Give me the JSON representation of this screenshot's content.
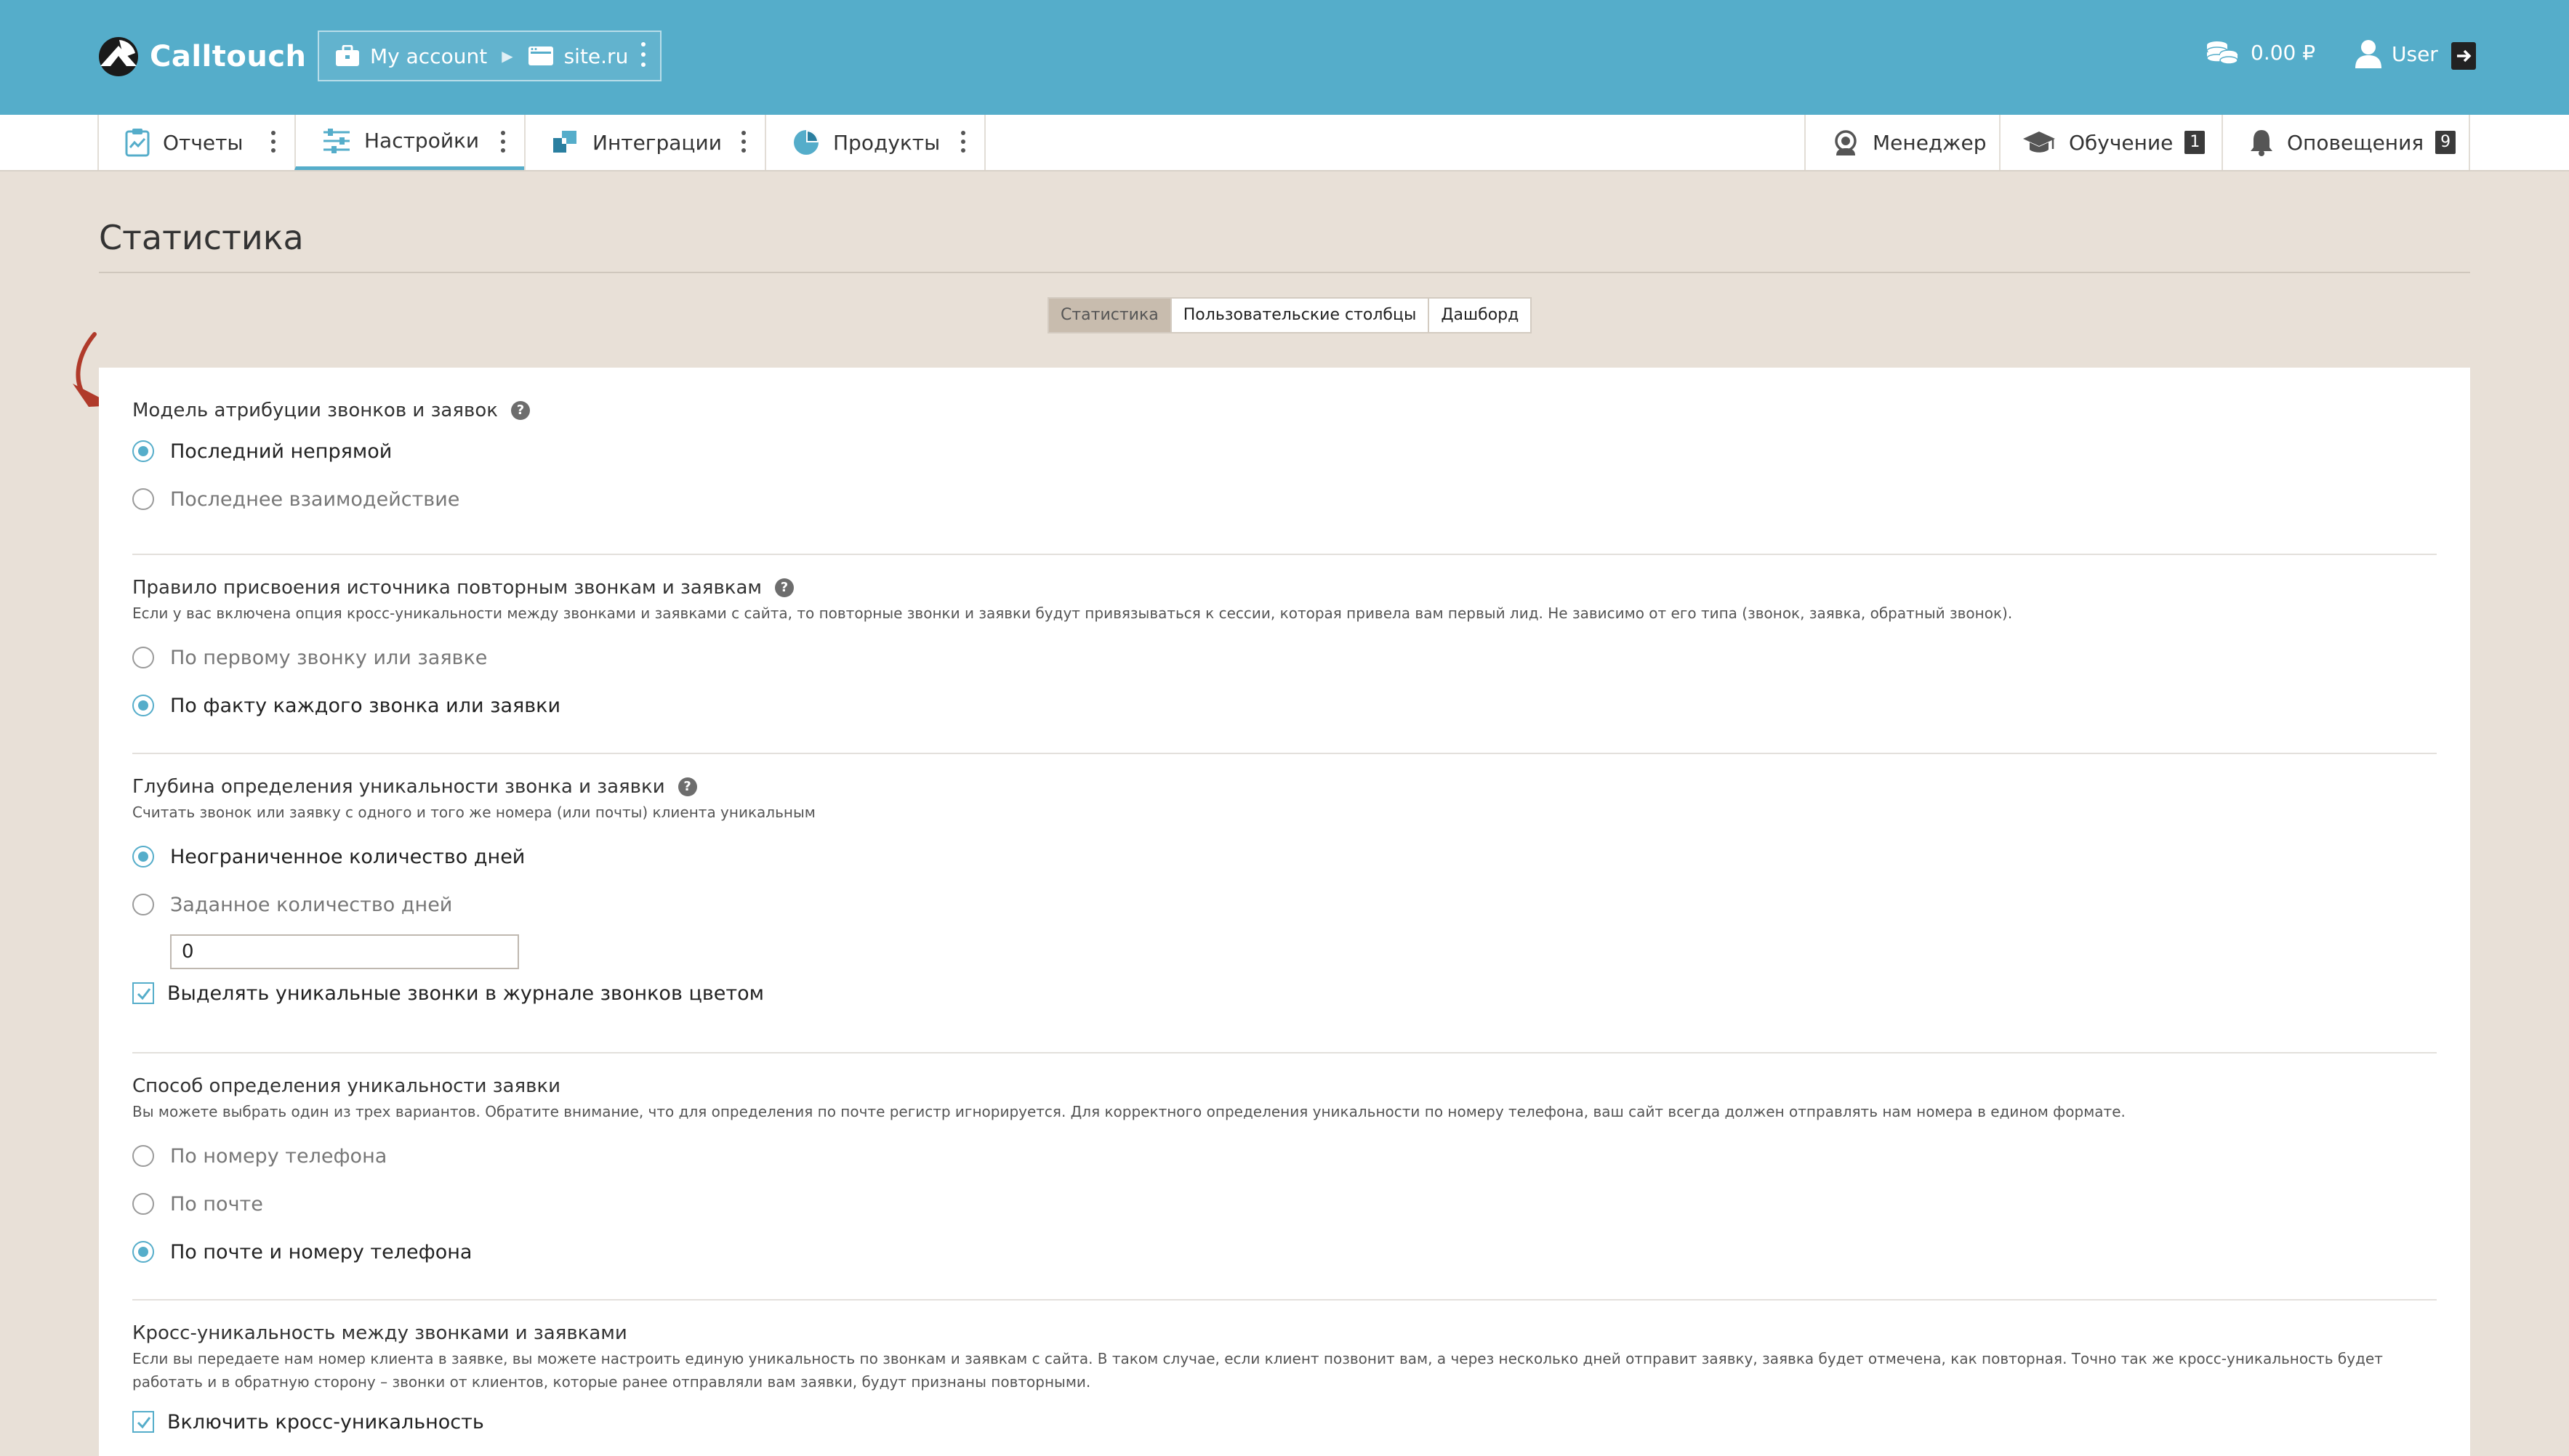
{
  "app": {
    "name": "Calltouch",
    "account_label": "My account",
    "site_label": "site.ru",
    "balance": "0.00 ₽",
    "user_label": "User"
  },
  "nav": {
    "left": [
      {
        "label": "Отчеты",
        "icon": "clipboard-chart-icon"
      },
      {
        "label": "Настройки",
        "icon": "sliders-icon",
        "active": true
      },
      {
        "label": "Интеграции",
        "icon": "puzzle-icon"
      },
      {
        "label": "Продукты",
        "icon": "pie-chart-icon"
      }
    ],
    "right": [
      {
        "label": "Менеджер",
        "icon": "headset-icon"
      },
      {
        "label": "Обучение",
        "icon": "graduation-cap-icon",
        "badge": "1"
      },
      {
        "label": "Оповещения",
        "icon": "bell-icon",
        "badge": "9"
      }
    ]
  },
  "page": {
    "title": "Статистика",
    "subtabs": [
      "Статистика",
      "Пользовательские столбцы",
      "Дашборд"
    ],
    "active_subtab": 0
  },
  "sections": {
    "attribution": {
      "title": "Модель атрибуции звонков и заявок",
      "options": [
        "Последний непрямой",
        "Последнее взаимодействие"
      ],
      "selected": 0
    },
    "repeat_rule": {
      "title": "Правило присвоения источника повторным звонкам и заявкам",
      "desc": "Если у вас включена опция кросс-уникальности между звонками и заявками с сайта, то повторные звонки и заявки будут привязываться к сессии, которая привела вам первый лид. Не зависимо от его типа (звонок, заявка, обратный звонок).",
      "options": [
        "По первому звонку или заявке",
        "По факту каждого звонка или заявки"
      ],
      "selected": 1
    },
    "uniqueness_depth": {
      "title": "Глубина определения уникальности звонка и заявки",
      "desc": "Считать звонок или заявку с одного и того же номера (или почты) клиента уникальным",
      "options": [
        "Неограниченное количество дней",
        "Заданное количество дней"
      ],
      "selected": 0,
      "days_value": "0",
      "highlight_label": "Выделять уникальные звонки в журнале звонков цветом",
      "highlight_checked": true
    },
    "request_uniqueness": {
      "title": "Способ определения уникальности заявки",
      "desc": "Вы можете выбрать один из трех вариантов. Обратите внимание, что для определения по почте регистр игнорируется. Для корректного определения уникальности по номеру телефона, ваш сайт всегда должен отправлять нам номера в едином формате.",
      "options": [
        "По номеру телефона",
        "По почте",
        "По почте и номеру телефона"
      ],
      "selected": 2
    },
    "cross_uniqueness": {
      "title": "Кросс-уникальность между звонками и заявками",
      "desc": "Если вы передаете нам номер клиента в заявке, вы можете настроить единую уникальность по звонкам и заявкам с сайта. В таком случае, если клиент позвонит вам, а через несколько дней отправит заявку, заявка будет отмечена, как повторная. Точно так же кросс-уникальность будет работать и в обратную сторону – звонки от клиентов, которые ранее отправляли вам заявки, будут признаны повторными.",
      "checkbox_label": "Включить кросс-уникальность",
      "checked": true
    }
  },
  "colors": {
    "header": "#55adca",
    "background": "#e8e0d7",
    "arrow": "#b03a2a"
  }
}
